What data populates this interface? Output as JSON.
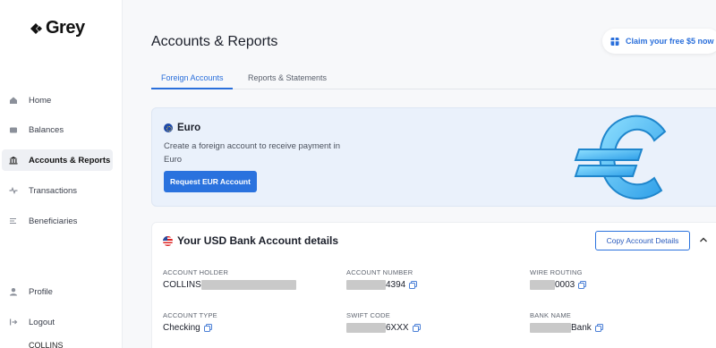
{
  "app": {
    "logo": "Grey"
  },
  "sidebar": {
    "items": [
      {
        "label": "Home",
        "icon": "home-icon"
      },
      {
        "label": "Balances",
        "icon": "wallet-icon"
      },
      {
        "label": "Accounts & Reports",
        "icon": "bank-icon",
        "active": true
      },
      {
        "label": "Transactions",
        "icon": "activity-icon"
      },
      {
        "label": "Beneficiaries",
        "icon": "list-icon"
      },
      {
        "label": "Profile",
        "icon": "user-icon"
      },
      {
        "label": "Logout",
        "icon": "logout-icon"
      }
    ],
    "user_name": "COLLINS"
  },
  "header": {
    "title": "Accounts & Reports",
    "claim_label": "Claim your free $5 now"
  },
  "tabs": [
    {
      "label": "Foreign Accounts",
      "active": true
    },
    {
      "label": "Reports & Statements",
      "active": false
    }
  ],
  "euro_card": {
    "title": "Euro",
    "description": "Create a foreign account to receive payment in Euro",
    "button_label": "Request EUR Account"
  },
  "usd_card": {
    "title": "Your USD Bank Account details",
    "copy_button_label": "Copy Account Details",
    "fields": {
      "account_holder": {
        "label": "ACCOUNT HOLDER",
        "value": "COLLINS"
      },
      "account_number": {
        "label": "ACCOUNT NUMBER",
        "value_suffix": "4394"
      },
      "wire_routing": {
        "label": "WIRE ROUTING",
        "value_suffix": "0003"
      },
      "account_type": {
        "label": "ACCOUNT TYPE",
        "value": "Checking"
      },
      "swift_code": {
        "label": "SWIFT CODE",
        "value_suffix": "6XXX"
      },
      "bank_name": {
        "label": "BANK NAME",
        "value_suffix": "Bank"
      }
    }
  },
  "colors": {
    "accent": "#2a72de",
    "active_nav_bg": "#eef0f4",
    "euro_card_bg": "#eaf1fb"
  }
}
